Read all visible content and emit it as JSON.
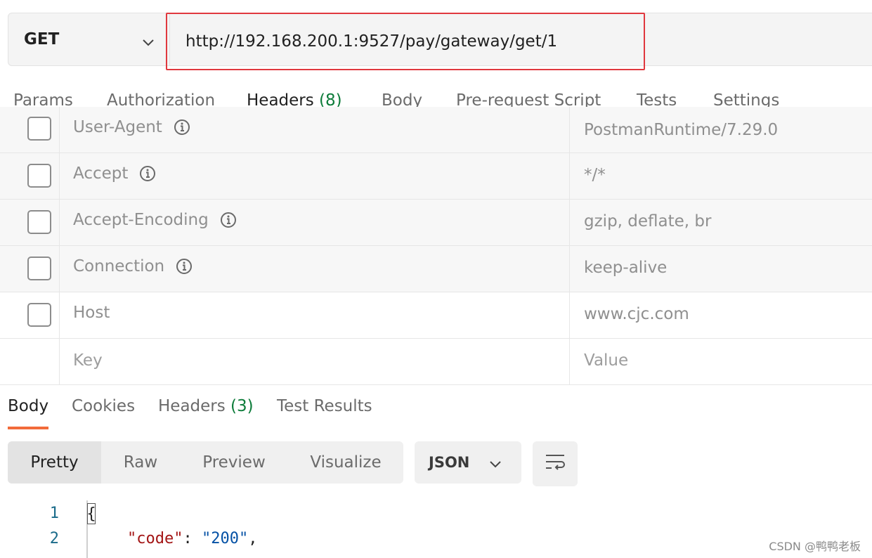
{
  "request": {
    "method": "GET",
    "url": "http://192.168.200.1:9527/pay/gateway/get/1"
  },
  "request_tabs": [
    {
      "label": "Params"
    },
    {
      "label": "Authorization"
    },
    {
      "label": "Headers",
      "count": "(8)"
    },
    {
      "label": "Body"
    },
    {
      "label": "Pre-request Script"
    },
    {
      "label": "Tests"
    },
    {
      "label": "Settings"
    }
  ],
  "headers_table": {
    "rows": [
      {
        "key": "User-Agent",
        "value": "PostmanRuntime/7.29.0"
      },
      {
        "key": "Accept",
        "value": "*/*"
      },
      {
        "key": "Accept-Encoding",
        "value": "gzip, deflate, br"
      },
      {
        "key": "Connection",
        "value": "keep-alive"
      },
      {
        "key": "Host",
        "value": "www.cjc.com"
      }
    ],
    "key_placeholder": "Key",
    "value_placeholder": "Value"
  },
  "response_tabs": [
    {
      "label": "Body"
    },
    {
      "label": "Cookies"
    },
    {
      "label": "Headers",
      "count": "(3)"
    },
    {
      "label": "Test Results"
    }
  ],
  "view_modes": [
    "Pretty",
    "Raw",
    "Preview",
    "Visualize"
  ],
  "format": "JSON",
  "code": {
    "line_numbers": [
      "1",
      "2"
    ],
    "line1": "{",
    "line2_key": "\"code\"",
    "line2_colon": ": ",
    "line2_value": "\"200\"",
    "line2_comma": ","
  },
  "watermark": "CSDN @鸭鸭老板",
  "colors": {
    "accent": "#f26b3a",
    "count_green": "#0d7c3a",
    "highlight_border": "#e0383e"
  },
  "icons": [
    "chevron-down-icon",
    "info-icon",
    "word-wrap-icon"
  ]
}
